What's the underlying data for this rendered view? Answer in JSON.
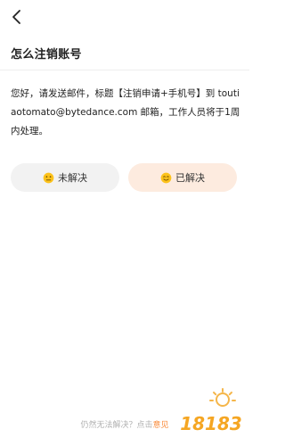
{
  "header": {
    "title": "怎么注销账号"
  },
  "content": {
    "body": "您好，请发送邮件，标题【注销申请+手机号】到 toutiaotomato@bytedance.com 邮箱，工作人员将于1周内处理。"
  },
  "feedback": {
    "unsolved_label": "未解决",
    "solved_label": "已解决",
    "unsolved_icon": "neutral-face-icon",
    "solved_icon": "smiling-face-icon"
  },
  "footer": {
    "prefix": "仍然无法解决？点击",
    "link": "意见"
  },
  "watermark": {
    "text": "18183"
  },
  "colors": {
    "accent": "#fa8c3c",
    "solved_bg": "#fdebdf",
    "unsolved_bg": "#f2f2f2"
  }
}
